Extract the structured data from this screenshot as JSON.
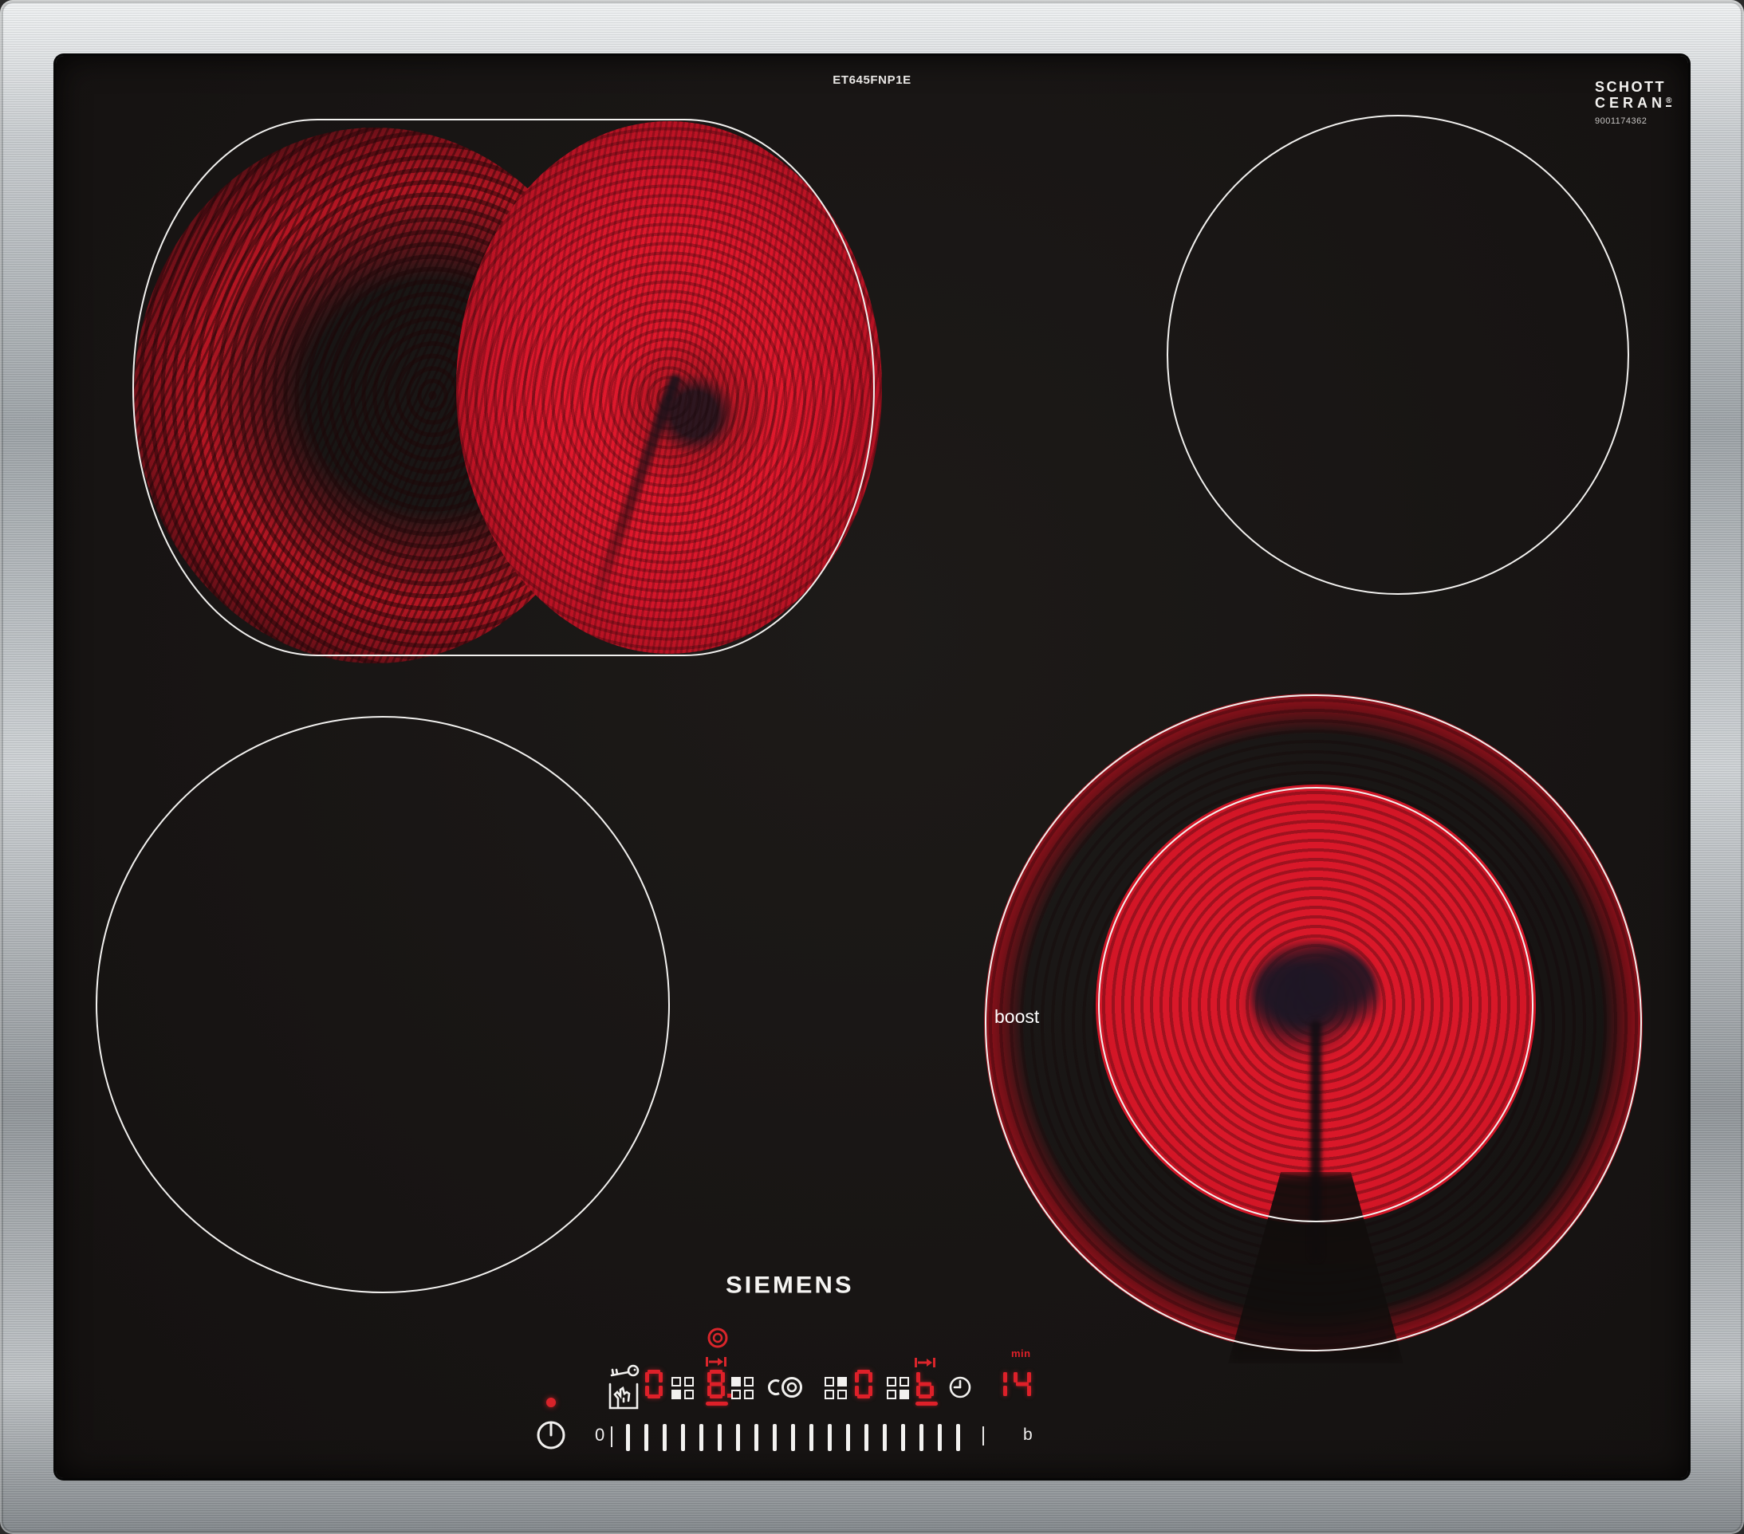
{
  "labels": {
    "model": "ET645FNP1E",
    "brand": "SIEMENS",
    "glass_brand_top": "SCHOTT",
    "glass_brand_bottom": "CERAN",
    "glass_brand_reg": "®",
    "glass_code": "9001174362",
    "boost": "boost"
  },
  "zones": {
    "back_left": {
      "name": "back-left dual oval zone",
      "state": "on"
    },
    "back_right": {
      "name": "back-right zone",
      "state": "off"
    },
    "front_left": {
      "name": "front-left zone",
      "state": "off"
    },
    "front_right": {
      "name": "front-right dual circle zone",
      "state": "on",
      "label": "boost"
    }
  },
  "control": {
    "zone_displays": [
      {
        "value": "0",
        "indicator": "bottom-left",
        "selected": false,
        "extend_icon": false
      },
      {
        "value": "8.",
        "indicator": "top-left",
        "selected": true,
        "extend_icon": true
      },
      {
        "value": "0",
        "indicator": "top-right",
        "selected": false,
        "extend_icon": false
      },
      {
        "value": "b",
        "indicator": "bottom-right",
        "selected": true,
        "extend_icon": true
      }
    ],
    "timer": {
      "value": "14",
      "unit": "min"
    },
    "slider": {
      "start": "0",
      "end": "b",
      "tick_count": 19
    }
  },
  "colors": {
    "led_red": "#de2029",
    "glow_red": "#d41726",
    "glass": "#171413",
    "steel": "#b9bdc0",
    "white": "#f2f1ef"
  }
}
